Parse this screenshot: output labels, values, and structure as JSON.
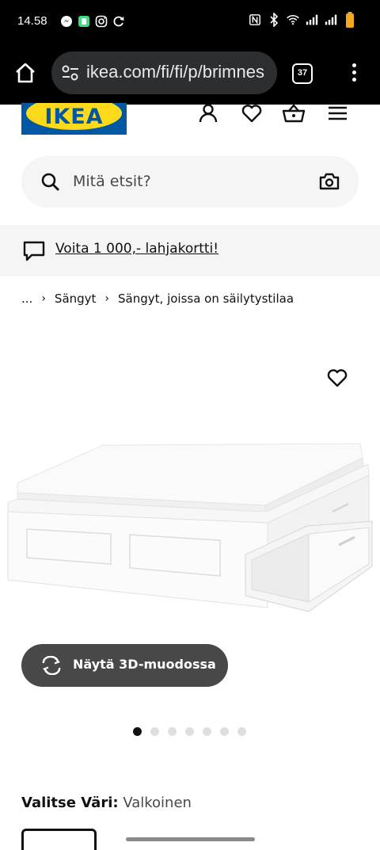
{
  "status_bar": {
    "time": "14.58",
    "icons_left": [
      "messenger-icon",
      "app-icon",
      "instagram-icon",
      "sync-icon"
    ],
    "icons_right": [
      "nfc-icon",
      "bluetooth-icon",
      "wifi-icon",
      "signal-icon",
      "signal-icon",
      "battery-icon"
    ]
  },
  "browser": {
    "url": "ikea.com/fi/fi/p/brimnes",
    "tab_count": "37"
  },
  "header": {
    "logo_text": "IKEA",
    "icons": [
      "account-icon",
      "favourites-icon",
      "cart-icon",
      "hamburger-menu-icon"
    ]
  },
  "search": {
    "placeholder": "Mitä etsit?"
  },
  "promo": {
    "text": "Voita 1 000,- lahjakortti!"
  },
  "breadcrumb": {
    "items": [
      "...",
      "Sängyt",
      "Sängyt, joissa on säilytystilaa"
    ],
    "separator": "›"
  },
  "product": {
    "view_3d_label": "Näytä 3D-muodossa",
    "image_count": 7,
    "active_image": 0
  },
  "variant": {
    "label": "Valitse Väri:",
    "value": "Valkoinen"
  },
  "colors": {
    "ikea_blue": "#0058a3",
    "ikea_yellow": "#ffda1a",
    "button_dark": "#484848"
  }
}
